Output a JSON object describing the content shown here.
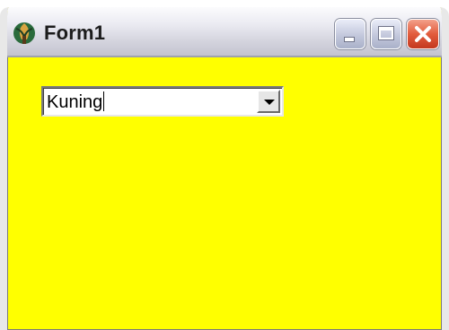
{
  "window": {
    "title": "Form1",
    "background_color": "#ffff00",
    "icon": "app-icon"
  },
  "titlebar_buttons": {
    "minimize_icon": "minimize-icon",
    "maximize_icon": "maximize-icon",
    "close_icon": "close-icon"
  },
  "combobox": {
    "value": "Kuning",
    "dropdown_icon": "chevron-down-icon"
  }
}
